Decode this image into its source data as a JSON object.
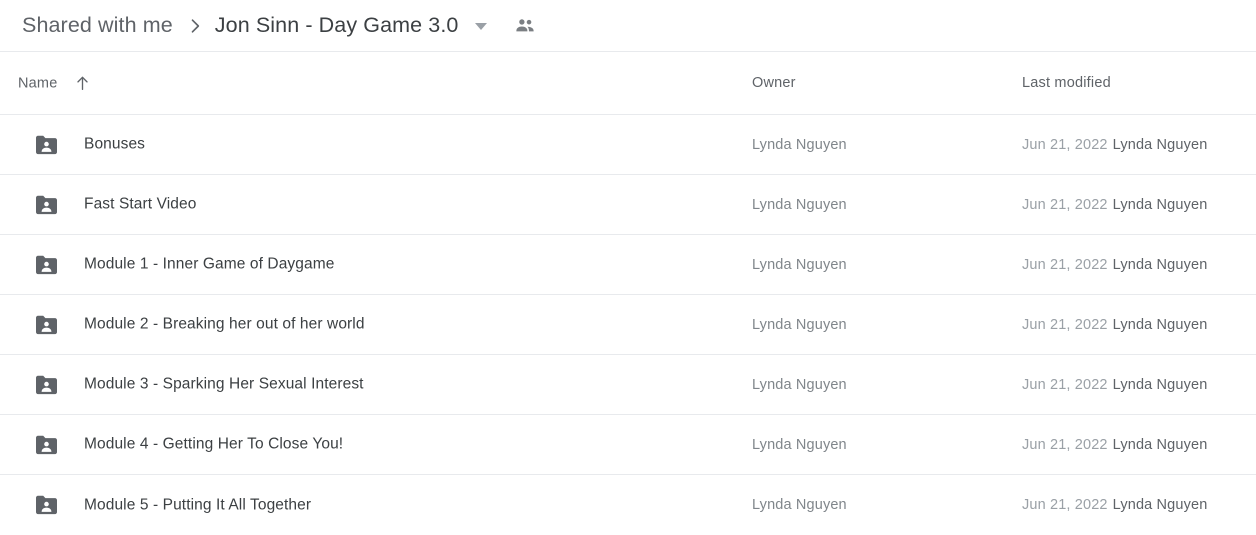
{
  "breadcrumb": {
    "parent_label": "Shared with me",
    "separator_icon": "chevron-right-icon",
    "current_label": "Jon Sinn - Day Game 3.0",
    "caret_icon": "chevron-down-icon",
    "share_icon": "people-icon"
  },
  "columns": {
    "name": "Name",
    "sort_icon": "arrow-up-icon",
    "owner": "Owner",
    "last_modified": "Last modified"
  },
  "colors": {
    "folder_icon": "#5f6368",
    "primary_text": "#3c4043",
    "secondary_text": "#5f6368",
    "muted_text": "#9aa0a6",
    "divider": "#e8eaed",
    "background": "#ffffff"
  },
  "rows": [
    {
      "icon": "shared-folder-icon",
      "name": "Bonuses",
      "owner": "Lynda Nguyen",
      "modified_date": "Jun 21, 2022",
      "modified_by": "Lynda Nguyen"
    },
    {
      "icon": "shared-folder-icon",
      "name": "Fast Start Video",
      "owner": "Lynda Nguyen",
      "modified_date": "Jun 21, 2022",
      "modified_by": "Lynda Nguyen"
    },
    {
      "icon": "shared-folder-icon",
      "name": "Module 1 - Inner Game of Daygame",
      "owner": "Lynda Nguyen",
      "modified_date": "Jun 21, 2022",
      "modified_by": "Lynda Nguyen"
    },
    {
      "icon": "shared-folder-icon",
      "name": "Module 2 - Breaking her out of her world",
      "owner": "Lynda Nguyen",
      "modified_date": "Jun 21, 2022",
      "modified_by": "Lynda Nguyen"
    },
    {
      "icon": "shared-folder-icon",
      "name": "Module 3 - Sparking Her Sexual Interest",
      "owner": "Lynda Nguyen",
      "modified_date": "Jun 21, 2022",
      "modified_by": "Lynda Nguyen"
    },
    {
      "icon": "shared-folder-icon",
      "name": "Module 4 - Getting Her To Close You!",
      "owner": "Lynda Nguyen",
      "modified_date": "Jun 21, 2022",
      "modified_by": "Lynda Nguyen"
    },
    {
      "icon": "shared-folder-icon",
      "name": "Module 5 - Putting It All Together",
      "owner": "Lynda Nguyen",
      "modified_date": "Jun 21, 2022",
      "modified_by": "Lynda Nguyen"
    }
  ]
}
